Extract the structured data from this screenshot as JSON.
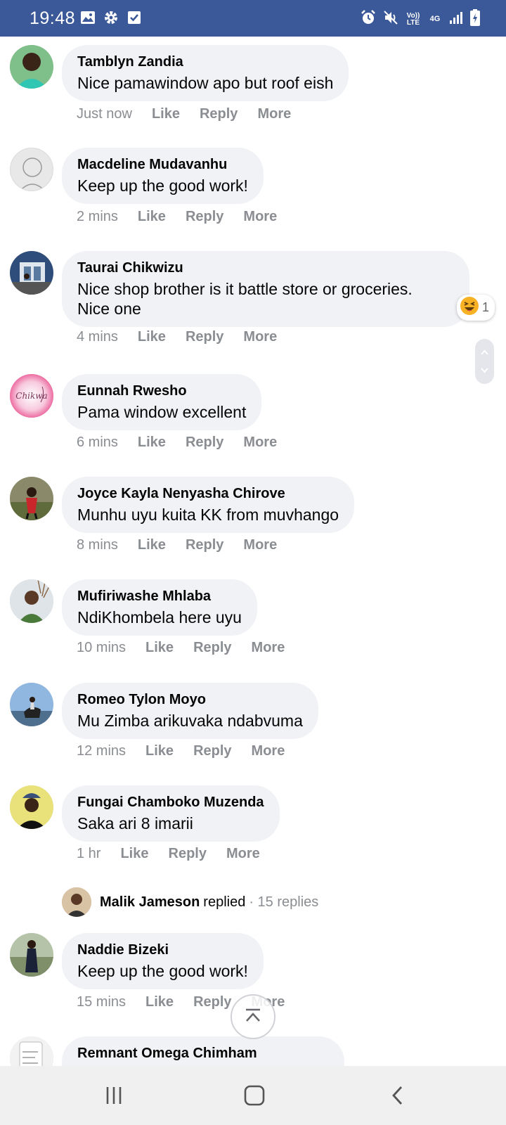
{
  "status_bar": {
    "time": "19:48",
    "left_icons": [
      "image-icon",
      "gear-icon",
      "checkbox-icon"
    ],
    "right_icons": [
      "alarm-icon",
      "mute-icon",
      "volte-icon",
      "4g-icon",
      "signal-icon",
      "battery-icon"
    ],
    "volte_label": "Vo)) LTE",
    "network_label": "4G"
  },
  "comments": [
    {
      "author": "Tamblyn Zandia",
      "text": "Nice pamawindow apo but roof eish",
      "time": "Just now",
      "like": "Like",
      "reply": "Reply",
      "more": "More"
    },
    {
      "author": "Macdeline Mudavanhu",
      "text": "Keep up the good work!",
      "time": "2 mins",
      "like": "Like",
      "reply": "Reply",
      "more": "More"
    },
    {
      "author": "Taurai Chikwizu",
      "text": "Nice shop brother is it battle store or groceries.\nNice one",
      "time": "4 mins",
      "like": "Like",
      "reply": "Reply",
      "more": "More",
      "reaction_count": "1"
    },
    {
      "author": "Eunnah Rwesho",
      "text": "Pama window excellent",
      "time": "6 mins",
      "like": "Like",
      "reply": "Reply",
      "more": "More"
    },
    {
      "author": "Joyce Kayla Nenyasha Chirove",
      "text": "Munhu uyu kuita KK from muvhango",
      "time": "8 mins",
      "like": "Like",
      "reply": "Reply",
      "more": "More"
    },
    {
      "author": "Mufiriwashe Mhlaba",
      "text": "NdiKhombela here uyu",
      "time": "10 mins",
      "like": "Like",
      "reply": "Reply",
      "more": "More"
    },
    {
      "author": "Romeo Tylon Moyo",
      "text": "Mu Zimba arikuvaka ndabvuma",
      "time": "12 mins",
      "like": "Like",
      "reply": "Reply",
      "more": "More"
    },
    {
      "author": "Fungai Chamboko Muzenda",
      "text": "Saka ari 8 imarii",
      "time": "1 hr",
      "like": "Like",
      "reply": "Reply",
      "more": "More"
    },
    {
      "author": "Naddie Bizeki",
      "text": "Keep up the good work!",
      "time": "15 mins",
      "like": "Like",
      "reply": "Reply",
      "more": "More"
    },
    {
      "author": "Remnant Omega Chimham",
      "text": ""
    }
  ],
  "replied": {
    "name": "Malik Jameson",
    "verb": "replied",
    "count": "· 15 replies"
  },
  "avatar_text": {
    "eunnah": "Chikwa"
  },
  "colors": {
    "status_bar": "#3b5998",
    "bubble": "#f0f2f5",
    "meta": "#8a8d91"
  }
}
